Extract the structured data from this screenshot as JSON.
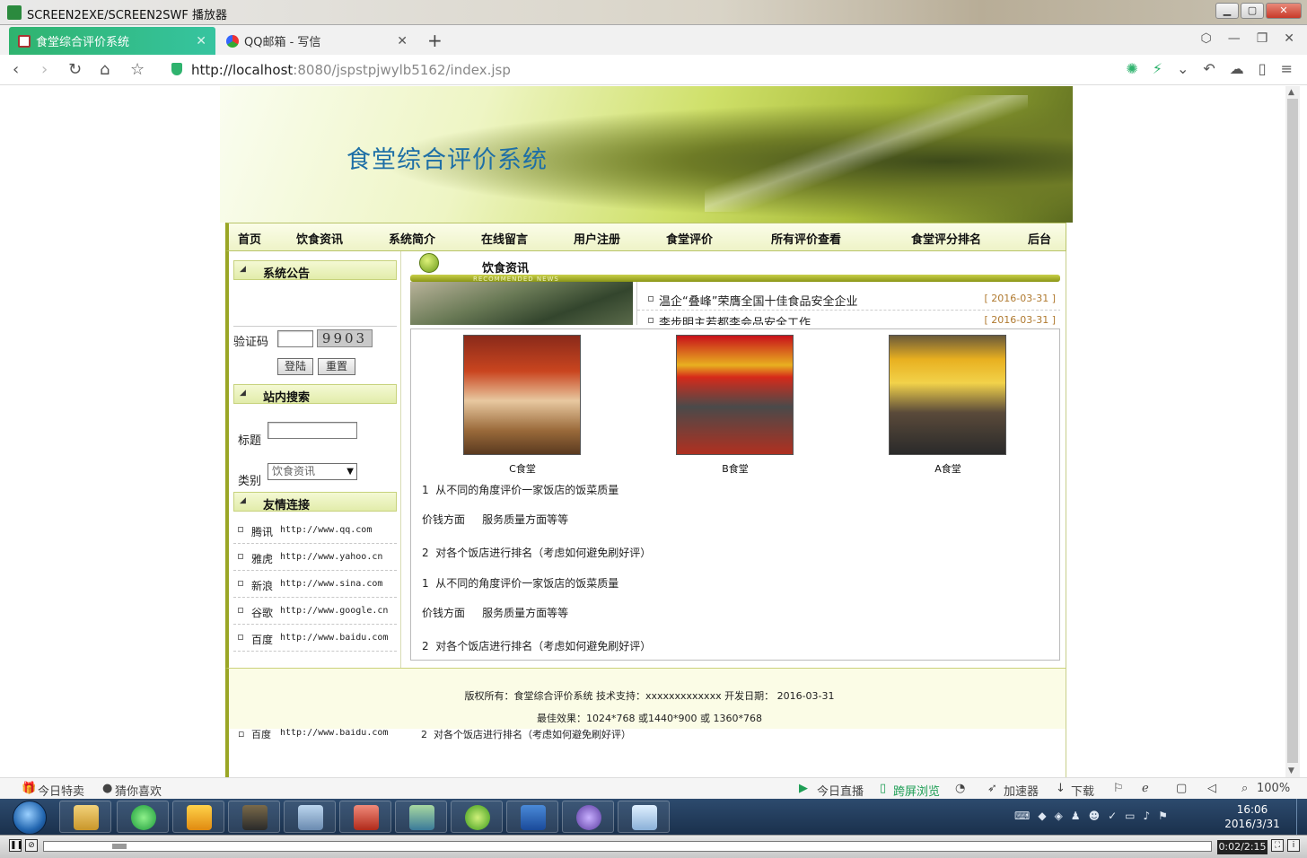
{
  "player": {
    "title": "SCREEN2EXE/SCREEN2SWF 播放器",
    "time": "0:02/2:15",
    "minimize": "▁",
    "maximize": "▢",
    "close": "✕"
  },
  "browser": {
    "tabs": [
      {
        "label": "食堂综合评价系统",
        "close": "✕"
      },
      {
        "label": "QQ邮箱 - 写信",
        "close": "✕"
      }
    ],
    "new_tab": "+",
    "url_host": "http://localhost",
    "url_path": ":8080/jspstpjwylb5162/index.jsp",
    "nav_icons": [
      "back-icon",
      "forward-icon",
      "reload-icon",
      "home-icon",
      "bookmark-star-icon"
    ],
    "zoom": "100%"
  },
  "site": {
    "banner_title": "食堂综合评价系统",
    "nav": [
      "首页",
      "饮食资讯",
      "系统简介",
      "在线留言",
      "用户注册",
      "食堂评价",
      "所有评价查看",
      "食堂评分排名",
      "后台"
    ],
    "left": {
      "notice_title": "系统公告",
      "captcha_label": "验证码",
      "captcha_value": "9903",
      "login_button": "登陆",
      "reset_button": "重置",
      "search_title": "站内搜索",
      "search_title_label": "标题",
      "category_label": "类别",
      "category_selected": "饮食资讯",
      "links_title": "友情连接",
      "links": [
        {
          "name": "腾讯",
          "url": "http://www.qq.com"
        },
        {
          "name": "雅虎",
          "url": "http://www.yahoo.cn"
        },
        {
          "name": "新浪",
          "url": "http://www.sina.com"
        },
        {
          "name": "谷歌",
          "url": "http://www.google.cn"
        },
        {
          "name": "百度",
          "url": "http://www.baidu.com"
        }
      ]
    },
    "news": {
      "title": "饮食资讯",
      "subtitle": "RECOMMENDED NEWS",
      "items": [
        {
          "text": "温企“叠峰”荣膺全国十佳食品安全企业",
          "date": "[ 2016-03-31 ]"
        },
        {
          "text": "李步明主若都李会品安全工作",
          "date": "[ 2016-03-31 ]"
        }
      ]
    },
    "canteens": [
      {
        "name": "C食堂"
      },
      {
        "name": "B食堂"
      },
      {
        "name": "A食堂"
      }
    ],
    "descriptions": [
      "1  从不同的角度评价一家饭店的饭菜质量",
      "价钱方面     服务质量方面等等",
      "2  对各个饭店进行排名（考虑如何避免刷好评）",
      "1  从不同的角度评价一家饭店的饭菜质量",
      "价钱方面     服务质量方面等等",
      "2  对各个饭店进行排名（考虑如何避免刷好评）"
    ],
    "footer": {
      "line1": "版权所有：食堂综合评价系统 技术支持：xxxxxxxxxxxxx 开发日期： 2016-03-31",
      "line2": "最佳效果：1024*768 或1440*900 或 1360*768"
    },
    "ghost_link": {
      "name": "百度",
      "url": "http://www.baidu.com"
    },
    "ghost_desc": "2  对各个饭店进行排名（考虑如何避免刷好评）"
  },
  "statusbar": {
    "deal": "今日特卖",
    "guess": "猜你喜欢",
    "live": "今日直播",
    "cross_screen": "跨屏浏览",
    "accelerator": "加速器",
    "download": "下载",
    "zoom": "100%"
  },
  "taskbar": {
    "time": "16:06",
    "date": "2016/3/31"
  }
}
